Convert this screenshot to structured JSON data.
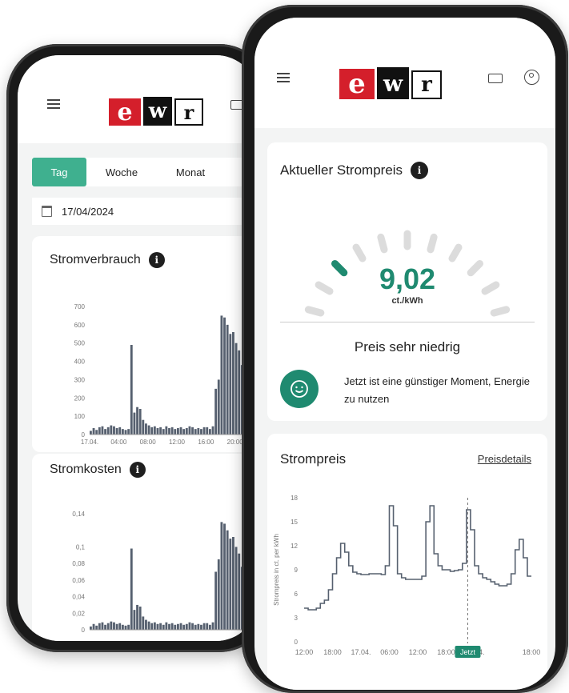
{
  "back_phone": {
    "tabs": [
      {
        "label": "Tag",
        "active": true
      },
      {
        "label": "Woche",
        "active": false
      },
      {
        "label": "Monat",
        "active": false
      }
    ],
    "date": "17/04/2024",
    "consumption": {
      "title": "Stromverbrauch"
    },
    "costs": {
      "title": "Stromkosten"
    }
  },
  "front_phone": {
    "current_price": {
      "title": "Aktueller Strompreis",
      "value": "9,02",
      "unit": "ct./kWh",
      "level_label": "Preis sehr niedrig",
      "advice": "Jetzt ist eine günstiger Moment, Energie zu nutzen"
    },
    "price_chart": {
      "title": "Strompreis",
      "link": "Preisdetails",
      "now_label": "Jetzt"
    }
  },
  "brand": {
    "letters": [
      "e",
      "w",
      "r"
    ],
    "accent": "#1f8a70",
    "red": "#d41f2b"
  },
  "chart_data": [
    {
      "type": "bar",
      "title": "Stromverbrauch",
      "ylim": [
        0,
        700
      ],
      "yticks": [
        "0",
        "100",
        "200",
        "300",
        "400",
        "500",
        "600",
        "700"
      ],
      "xticks": [
        "17.04.",
        "04:00",
        "08:00",
        "12:00",
        "16:00",
        "20:00"
      ],
      "values": [
        20,
        35,
        25,
        40,
        45,
        30,
        40,
        50,
        45,
        35,
        40,
        30,
        25,
        30,
        490,
        120,
        150,
        140,
        80,
        60,
        50,
        40,
        45,
        35,
        40,
        30,
        45,
        35,
        40,
        30,
        35,
        40,
        30,
        35,
        45,
        40,
        30,
        35,
        30,
        40,
        40,
        30,
        45,
        250,
        300,
        650,
        640,
        600,
        550,
        560,
        500,
        460,
        380,
        300,
        40,
        35,
        30,
        25,
        30,
        45
      ]
    },
    {
      "type": "bar",
      "title": "Stromkosten",
      "yticks": [
        "0",
        "0,02",
        "0,04",
        "0,06",
        "0,08",
        "0,1",
        "0,14"
      ],
      "xticks": [],
      "values": [
        0.004,
        0.007,
        0.005,
        0.008,
        0.009,
        0.006,
        0.008,
        0.01,
        0.009,
        0.007,
        0.008,
        0.006,
        0.005,
        0.006,
        0.098,
        0.024,
        0.03,
        0.028,
        0.016,
        0.012,
        0.01,
        0.008,
        0.009,
        0.007,
        0.008,
        0.006,
        0.009,
        0.007,
        0.008,
        0.006,
        0.007,
        0.008,
        0.006,
        0.007,
        0.009,
        0.008,
        0.006,
        0.007,
        0.006,
        0.008,
        0.008,
        0.006,
        0.009,
        0.07,
        0.085,
        0.13,
        0.128,
        0.12,
        0.11,
        0.112,
        0.1,
        0.092,
        0.076,
        0.06,
        0.008,
        0.007,
        0.006,
        0.005,
        0.006,
        0.009
      ]
    },
    {
      "type": "line",
      "title": "Strompreis",
      "ylabel": "Strompreis in ct. per kWh",
      "ylim": [
        0,
        18
      ],
      "yticks": [
        "0",
        "3",
        "6",
        "9",
        "12",
        "15",
        "18"
      ],
      "xticks": [
        "12:00",
        "18:00",
        "17.04.",
        "06:00",
        "12:00",
        "18:00",
        "18.04.",
        "06:00",
        "18:00"
      ],
      "values": [
        4.2,
        4.0,
        4.0,
        4.2,
        4.8,
        5.2,
        6.5,
        8.5,
        10.5,
        12.3,
        11.2,
        9.5,
        8.7,
        8.5,
        8.4,
        8.4,
        8.5,
        8.5,
        8.5,
        8.4,
        9.5,
        17.0,
        14.5,
        8.5,
        8.0,
        7.8,
        7.8,
        7.8,
        7.8,
        8.2,
        15.0,
        17.0,
        11.0,
        9.5,
        9.0,
        9.0,
        8.8,
        8.9,
        9.0,
        9.8,
        16.5,
        14.0,
        9.5,
        8.5,
        8.0,
        7.8,
        7.5,
        7.2,
        7.0,
        7.0,
        7.2,
        8.5,
        11.5,
        12.8,
        10.5,
        8.2
      ]
    }
  ]
}
